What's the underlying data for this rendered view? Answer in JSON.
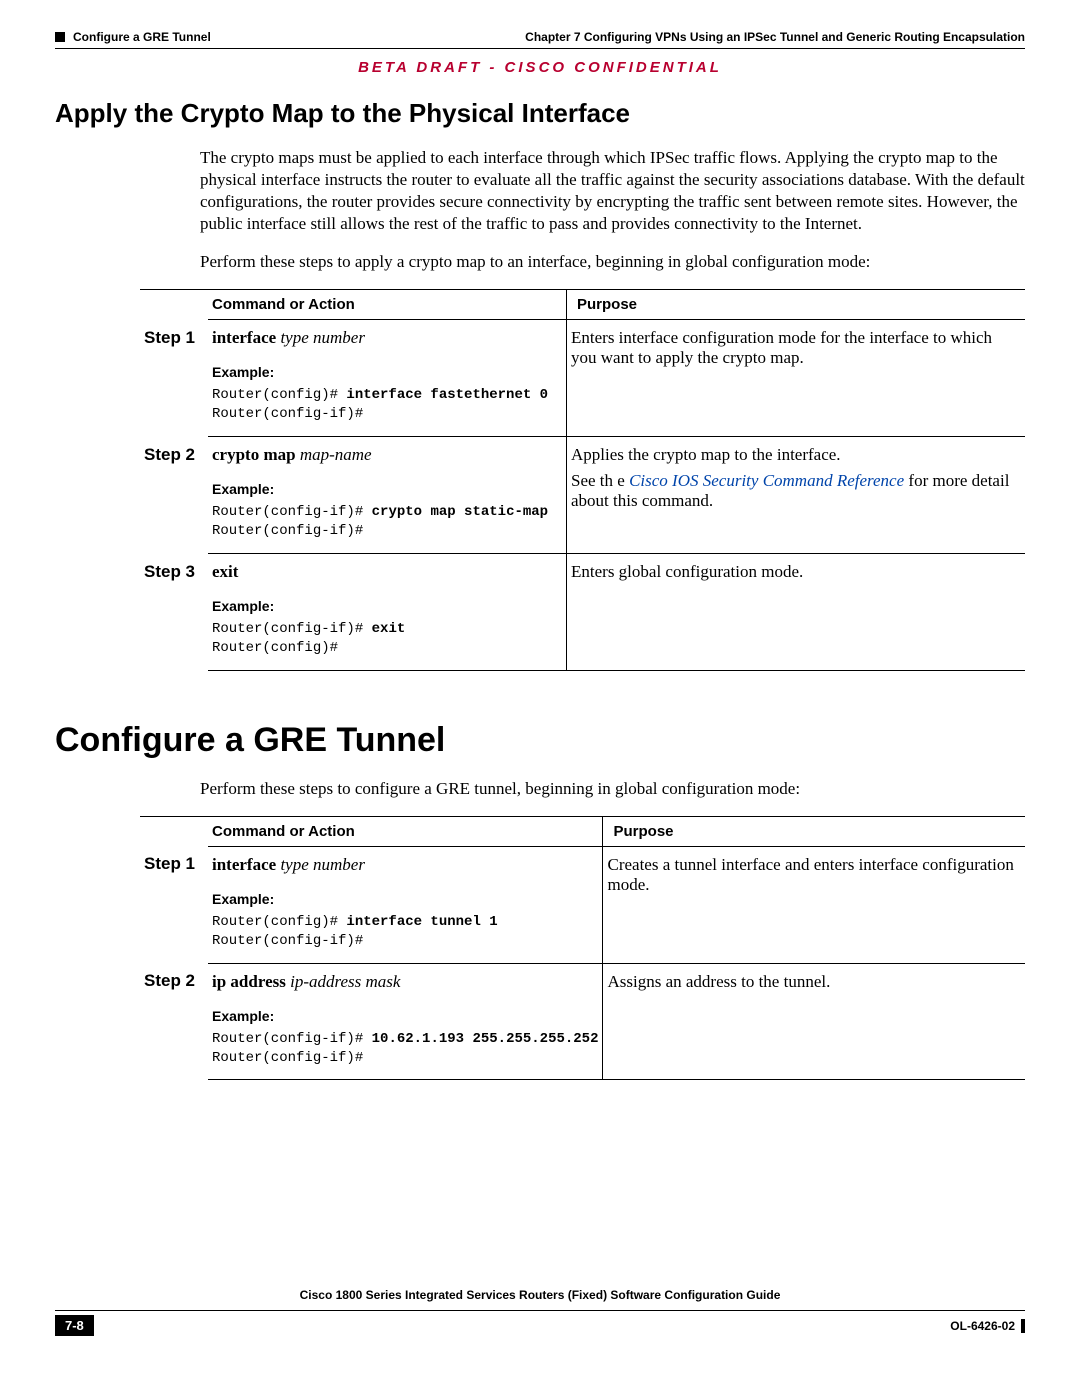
{
  "header": {
    "chapter_ref": "Chapter 7    Configuring VPNs Using an IPSec Tunnel and Generic Routing Encapsulation",
    "section_ref": "Configure a GRE Tunnel"
  },
  "beta_line": "BETA DRAFT - CISCO CONFIDENTIAL",
  "section1": {
    "title": "Apply the Crypto Map to the Physical Interface",
    "p1": "The crypto maps must be applied to each interface through which IPSec traffic flows. Applying the crypto map to the physical interface instructs the router to evaluate all the traffic against the security associations database. With the default configurations, the router provides secure connectivity by encrypting the traffic sent between remote sites. However, the public interface still allows the rest of the traffic to pass and provides connectivity to the Internet.",
    "p2": "Perform these steps to apply a crypto map to an interface, beginning in global configuration mode:",
    "table": {
      "h_cmd": "Command or Action",
      "h_purp": "Purpose",
      "rows": [
        {
          "step": "Step 1",
          "cmd_bold": "interface",
          "cmd_italic": " type number",
          "example_label": "Example:",
          "code_pre": "Router(config)# ",
          "code_bold": "interface fastethernet 0",
          "code_post": "Router(config-if)#",
          "purpose": "Enters interface configuration mode for the interface to which you want to apply the crypto map."
        },
        {
          "step": "Step 2",
          "cmd_bold": "crypto map",
          "cmd_italic": " map-name",
          "example_label": "Example:",
          "code_pre": "Router(config-if)# ",
          "code_bold": "crypto map static-map",
          "code_post": "Router(config-if)#",
          "purpose_a": "Applies the crypto map to the interface.",
          "purpose_b_pre": "See th e ",
          "purpose_link": "Cisco IOS Security Command Reference",
          "purpose_b_post": " for more detail about this command."
        },
        {
          "step": "Step 3",
          "cmd_bold": "exit",
          "cmd_italic": "",
          "example_label": "Example:",
          "code_pre": "Router(config-if)# ",
          "code_bold": "exit",
          "code_post": "Router(config)#",
          "purpose": "Enters global configuration mode."
        }
      ]
    }
  },
  "section2": {
    "title": "Configure a GRE Tunnel",
    "p1": "Perform these steps to configure a GRE tunnel, beginning in global configuration mode:",
    "table": {
      "h_cmd": "Command or Action",
      "h_purp": "Purpose",
      "rows": [
        {
          "step": "Step 1",
          "cmd_bold": "interface",
          "cmd_italic": " type number",
          "example_label": "Example:",
          "code_pre": "Router(config)# ",
          "code_bold": "interface tunnel 1",
          "code_post": "Router(config-if)#",
          "purpose": "Creates a tunnel interface and enters interface configuration mode."
        },
        {
          "step": "Step 2",
          "cmd_bold": "ip address",
          "cmd_italic": " ip-address mask",
          "example_label": "Example:",
          "code_pre": "Router(config-if)# ",
          "code_bold": "10.62.1.193 255.255.255.252",
          "code_post": "Router(config-if)#",
          "purpose": "Assigns an address to the tunnel."
        }
      ]
    }
  },
  "footer": {
    "book": "Cisco 1800 Series Integrated Services Routers (Fixed) Software Configuration Guide",
    "page": "7-8",
    "doc": "OL-6426-02"
  }
}
